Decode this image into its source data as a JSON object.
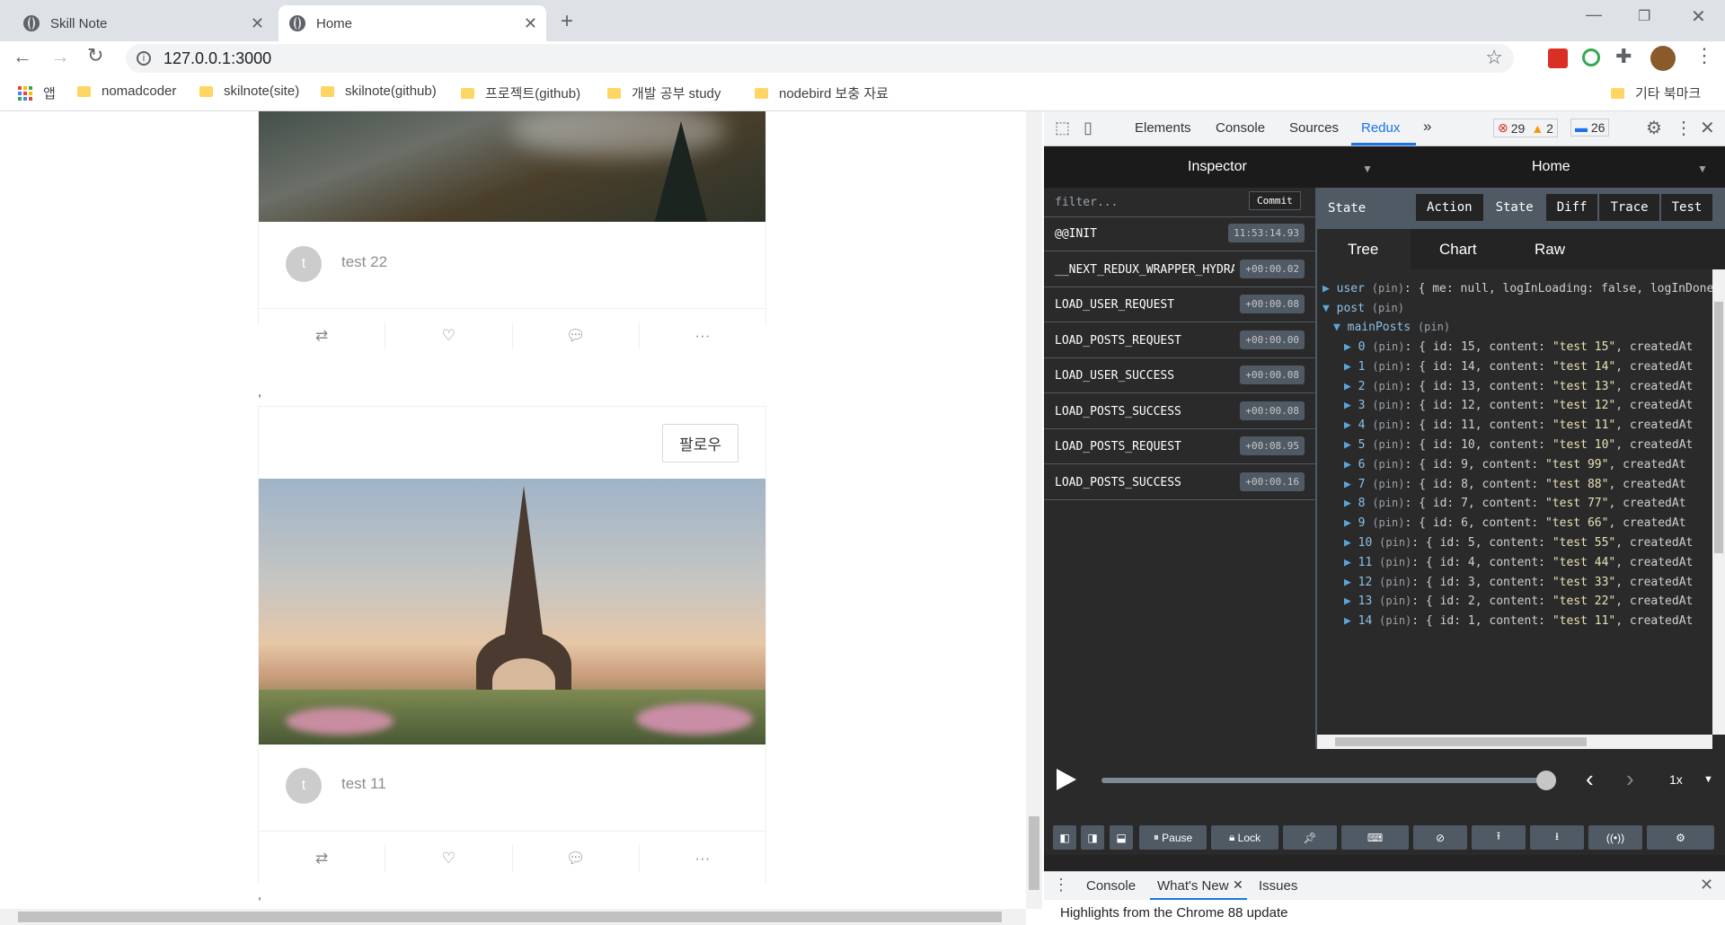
{
  "browser": {
    "tabs": [
      {
        "title": "Skill Note"
      },
      {
        "title": "Home"
      }
    ],
    "url": "127.0.0.1:3000",
    "bookmarks": [
      "앱",
      "nomadcoder",
      "skilnote(site)",
      "skilnote(github)",
      "프로젝트(github)",
      "개발 공부 study",
      "nodebird 보충 자료"
    ],
    "other_bookmarks": "기타 북마크"
  },
  "page": {
    "posts": [
      {
        "avatar_letter": "t",
        "content": "test 22"
      },
      {
        "follow_label": "팔로우",
        "avatar_letter": "t",
        "content": "test 11"
      }
    ],
    "separator": ","
  },
  "devtools": {
    "tabs": [
      "Elements",
      "Console",
      "Sources",
      "Redux"
    ],
    "more": "»",
    "errors": "29",
    "warnings": "2",
    "messages": "26",
    "monitor_left": "Inspector",
    "monitor_right": "Home",
    "filter_placeholder": "filter...",
    "commit_label": "Commit",
    "actions": [
      {
        "name": "@@INIT",
        "time": "11:53:14.93"
      },
      {
        "name": "__NEXT_REDUX_WRAPPER_HYDRATE__",
        "time": "+00:00.02"
      },
      {
        "name": "LOAD_USER_REQUEST",
        "time": "+00:00.08"
      },
      {
        "name": "LOAD_POSTS_REQUEST",
        "time": "+00:00.00"
      },
      {
        "name": "LOAD_USER_SUCCESS",
        "time": "+00:00.08"
      },
      {
        "name": "LOAD_POSTS_SUCCESS",
        "time": "+00:00.08"
      },
      {
        "name": "LOAD_POSTS_REQUEST",
        "time": "+00:08.95"
      },
      {
        "name": "LOAD_POSTS_SUCCESS",
        "time": "+00:00.16"
      }
    ],
    "state_label": "State",
    "inspector_tabs": [
      "Action",
      "State",
      "Diff",
      "Trace",
      "Test"
    ],
    "view_tabs": [
      "Tree",
      "Chart",
      "Raw"
    ],
    "tree": {
      "user_line": "user",
      "user_value": "{ me: null, logInLoading: false, logInDone",
      "post_line": "post",
      "main_posts": "mainPosts",
      "pin": "(pin)",
      "items": [
        {
          "index": "0",
          "id": "15",
          "content": "\"test 15\""
        },
        {
          "index": "1",
          "id": "14",
          "content": "\"test 14\""
        },
        {
          "index": "2",
          "id": "13",
          "content": "\"test 13\""
        },
        {
          "index": "3",
          "id": "12",
          "content": "\"test 12\""
        },
        {
          "index": "4",
          "id": "11",
          "content": "\"test 11\""
        },
        {
          "index": "5",
          "id": "10",
          "content": "\"test 10\""
        },
        {
          "index": "6",
          "id": "9",
          "content": "\"test 99\""
        },
        {
          "index": "7",
          "id": "8",
          "content": "\"test 88\""
        },
        {
          "index": "8",
          "id": "7",
          "content": "\"test 77\""
        },
        {
          "index": "9",
          "id": "6",
          "content": "\"test 66\""
        },
        {
          "index": "10",
          "id": "5",
          "content": "\"test 55\""
        },
        {
          "index": "11",
          "id": "4",
          "content": "\"test 44\""
        },
        {
          "index": "12",
          "id": "3",
          "content": "\"test 33\""
        },
        {
          "index": "13",
          "id": "2",
          "content": "\"test 22\""
        },
        {
          "index": "14",
          "id": "1",
          "content": "\"test 11\""
        }
      ]
    },
    "playback_speed": "1x",
    "pause_label": "Pause",
    "lock_label": "Lock",
    "drawer_tabs": [
      "Console",
      "What's New",
      "Issues"
    ],
    "drawer_text": "Highlights from the Chrome 88 update"
  }
}
